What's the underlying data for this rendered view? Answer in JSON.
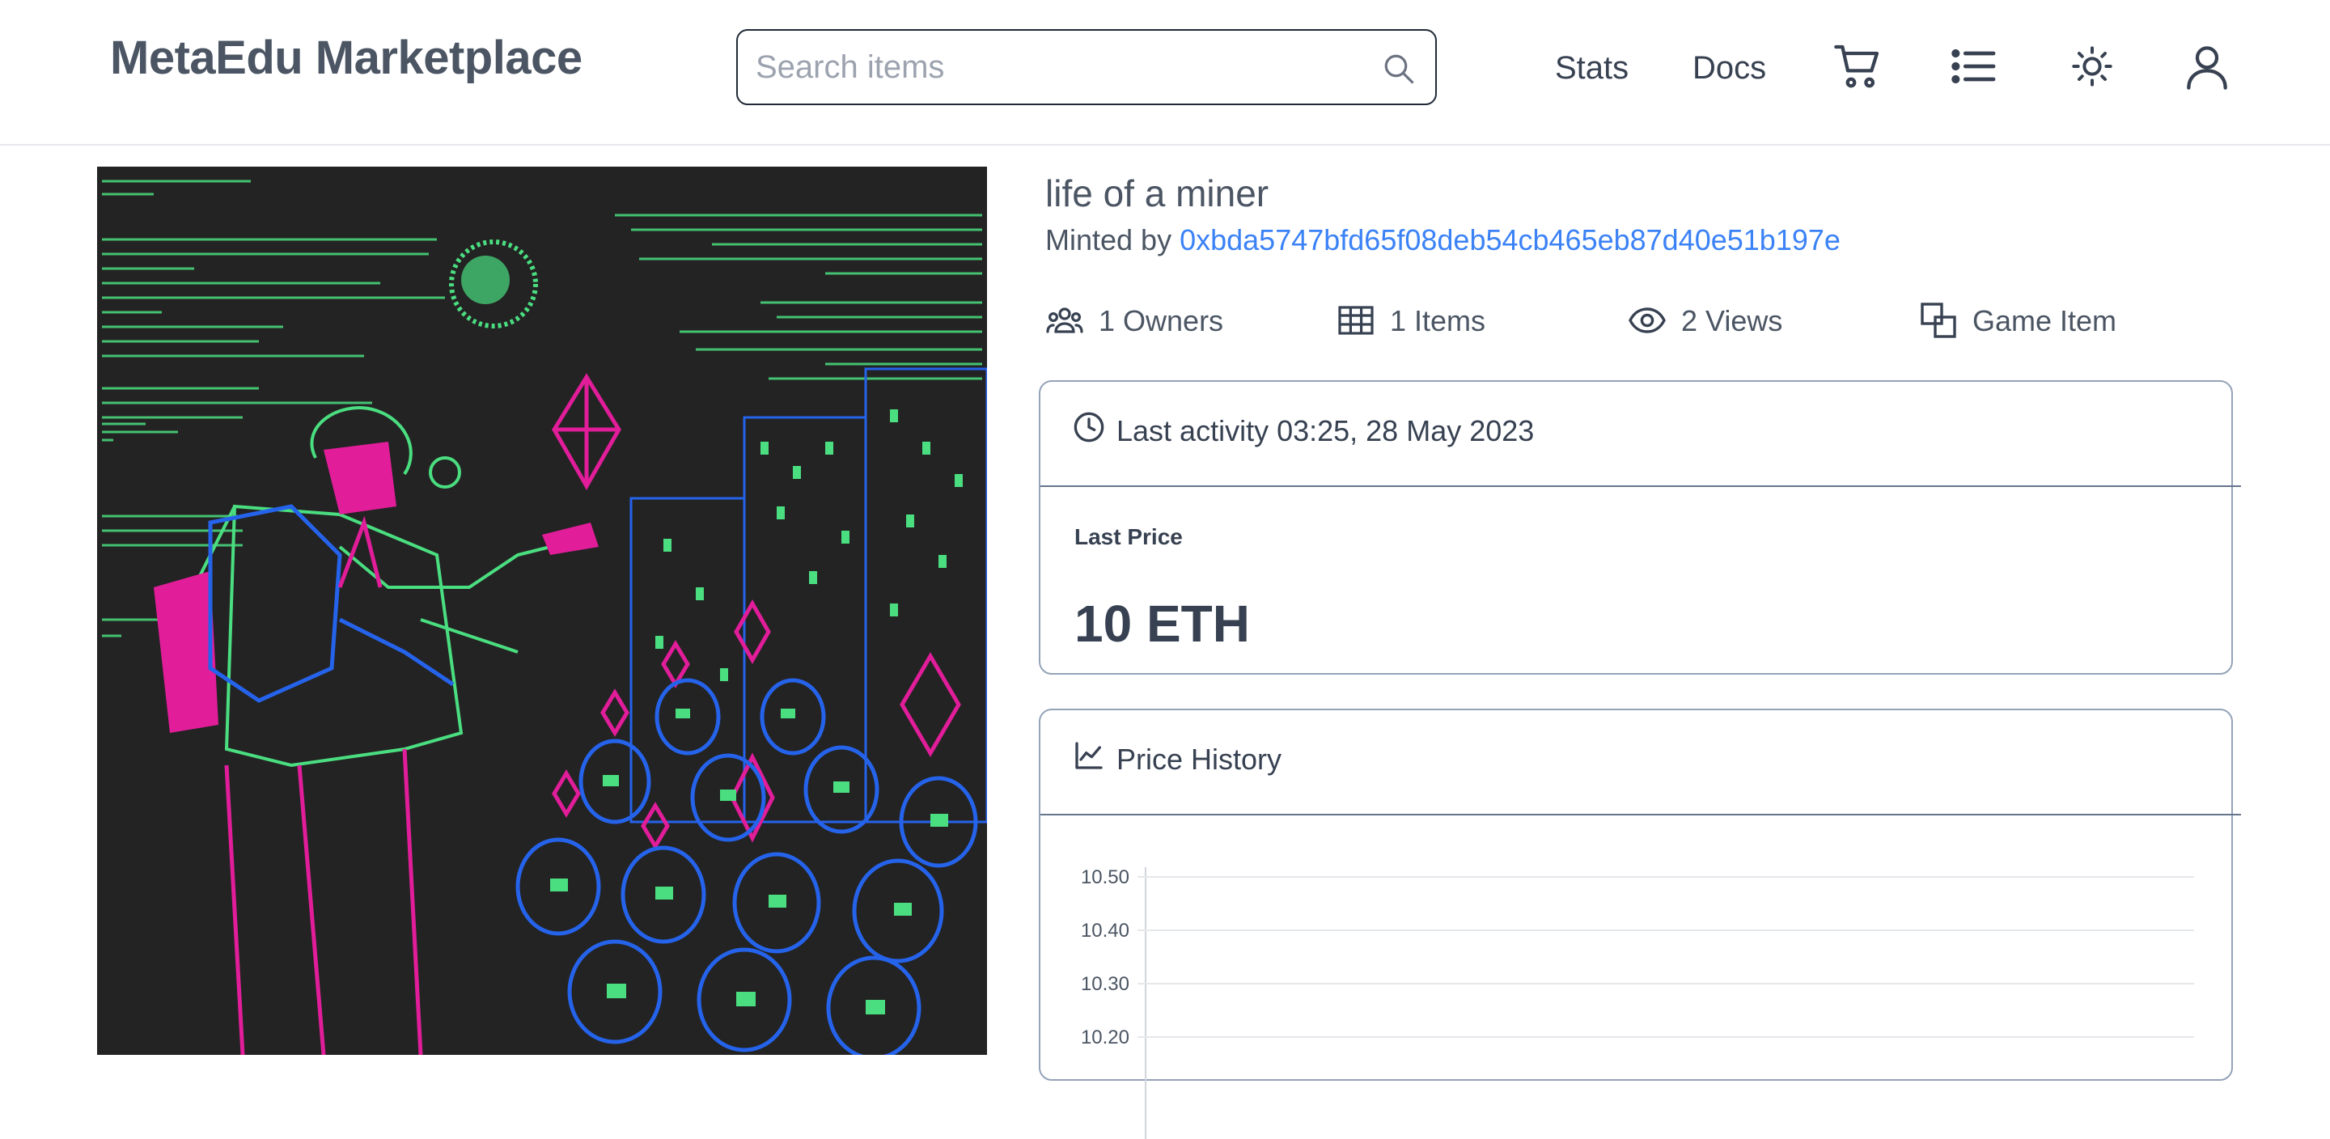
{
  "header": {
    "brand": "MetaEdu Marketplace",
    "search_placeholder": "Search items",
    "nav": {
      "stats": "Stats",
      "docs": "Docs"
    }
  },
  "item": {
    "title": "life of a miner",
    "minted_prefix": "Minted by",
    "minter_address": "0xbda5747bfd65f08deb54cb465eb87d40e51b197e",
    "stats": {
      "owners": "1 Owners",
      "items": "1 Items",
      "views": "2 Views",
      "category": "Game Item"
    }
  },
  "activity": {
    "last_activity": "Last activity 03:25, 28 May 2023",
    "last_price_label": "Last Price",
    "last_price_value": "10 ETH"
  },
  "price_history": {
    "title": "Price History"
  },
  "chart_data": {
    "type": "line",
    "title": "",
    "xlabel": "",
    "ylabel": "",
    "y_ticks": [
      "10.50",
      "10.40",
      "10.30",
      "10.20"
    ],
    "ylim": [
      10.2,
      10.5
    ],
    "grid": true,
    "series": []
  },
  "colors": {
    "link": "#3b82f6",
    "text": "#374151",
    "border": "#94a3b8",
    "art_bg": "#232323",
    "art_green": "#4ade80",
    "art_magenta": "#e11d9a",
    "art_blue": "#2563eb"
  }
}
